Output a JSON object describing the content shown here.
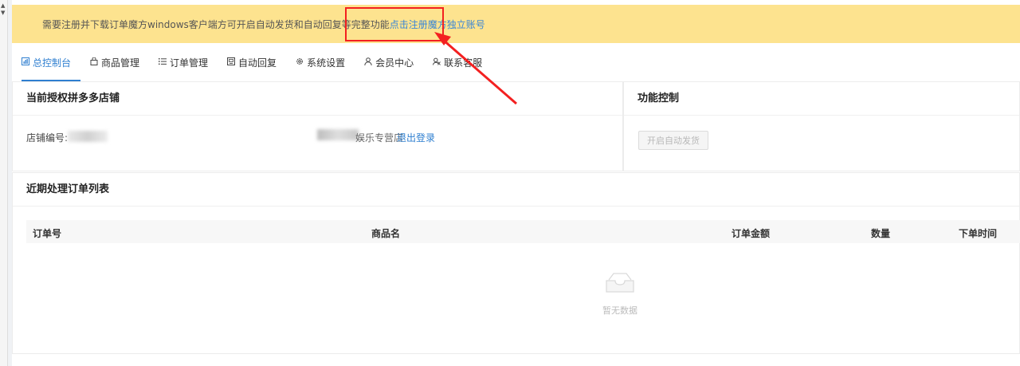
{
  "banner": {
    "text": "需要注册并下载订单魔方windows客户端方可开启自动发货和自动回复等完整功能",
    "link": "点击注册魔方独立账号"
  },
  "nav": {
    "items": [
      {
        "icon": "dashboard-icon",
        "label": "总控制台",
        "active": true
      },
      {
        "icon": "bag-icon",
        "label": "商品管理"
      },
      {
        "icon": "list-icon",
        "label": "订单管理"
      },
      {
        "icon": "chat-icon",
        "label": "自动回复"
      },
      {
        "icon": "gear-icon",
        "label": "系统设置"
      },
      {
        "icon": "user-icon",
        "label": "会员中心"
      },
      {
        "icon": "support-icon",
        "label": "联系客服"
      }
    ]
  },
  "store_panel": {
    "title": "当前授权拼多多店铺",
    "store_id_label": "店铺编号:",
    "store_name": "娱乐专营店",
    "logout": "退出登录"
  },
  "func_panel": {
    "title": "功能控制",
    "auto_ship_button": "开启自动发货"
  },
  "orders_panel": {
    "title": "近期处理订单列表",
    "columns": [
      "订单号",
      "商品名",
      "订单金额",
      "数量",
      "下单时间"
    ],
    "rows": [],
    "empty_text": "暂无数据"
  },
  "colors": {
    "banner_bg": "#fde38f",
    "accent": "#2f7fd0",
    "highlight": "#f32020"
  }
}
